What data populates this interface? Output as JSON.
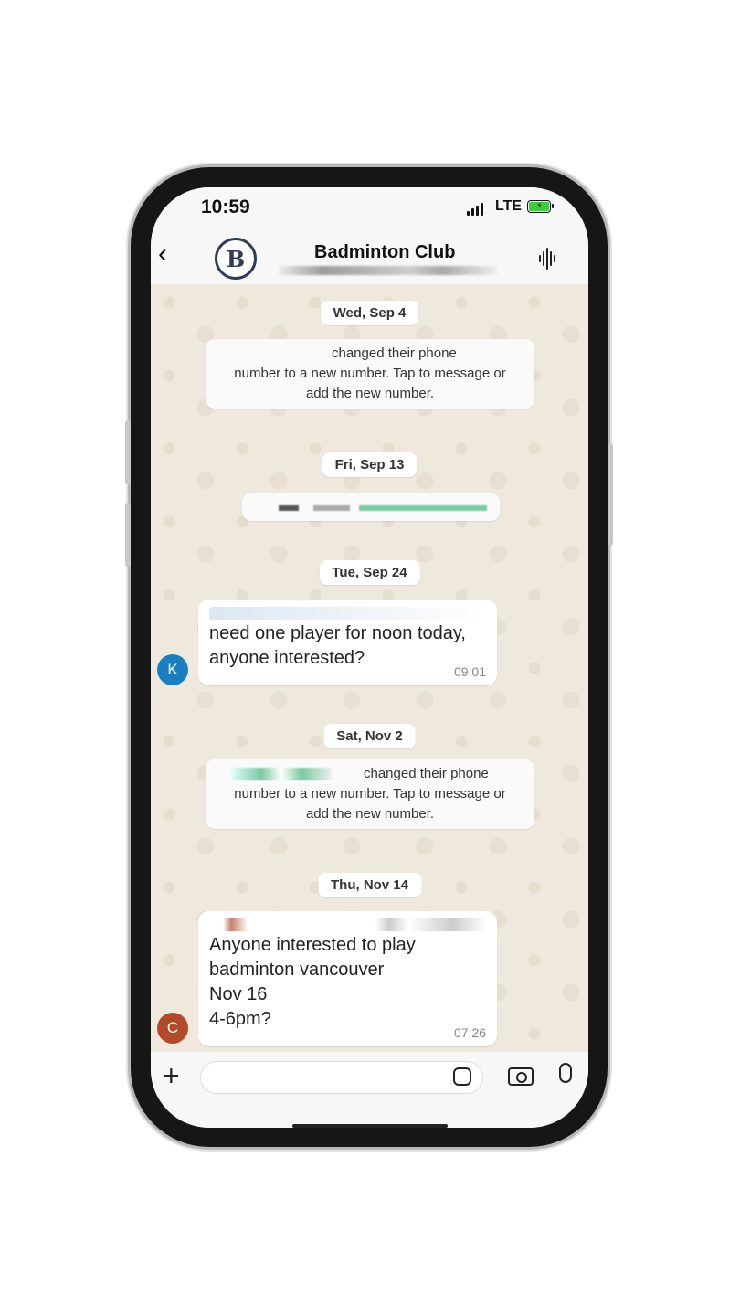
{
  "status_bar": {
    "time": "10:59",
    "network": "LTE"
  },
  "header": {
    "title": "Badminton Club",
    "avatar_letter": "B"
  },
  "chat": {
    "dates": [
      "Wed, Sep 4",
      "Fri, Sep 13",
      "Tue, Sep 24",
      "Sat, Nov 2",
      "Thu, Nov 14"
    ],
    "system_messages": [
      {
        "line1": "changed their phone",
        "line2": "number to a new number. Tap to message or",
        "line3": "add the new number."
      },
      {
        "line1": "changed their phone",
        "line2": "number to a new number. Tap to message or",
        "line3": "add the new number."
      }
    ],
    "messages": [
      {
        "avatar": "K",
        "avatar_color": "#1a7fc1",
        "text": "need one player for noon today,\nanyone interested?",
        "time": "09:01"
      },
      {
        "avatar": "C",
        "avatar_color": "#b24a2a",
        "text": "Anyone interested to play\nbadminton vancouver\nNov 16\n4-6pm?",
        "time": "07:26"
      }
    ]
  },
  "input_bar": {
    "placeholder": ""
  }
}
